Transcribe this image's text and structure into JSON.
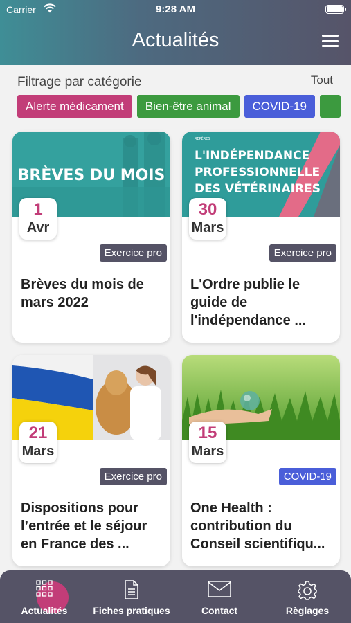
{
  "status_bar": {
    "carrier": "Carrier",
    "time": "9:28 AM"
  },
  "header": {
    "title": "Actualités"
  },
  "filter": {
    "label": "Filtrage par catégorie",
    "all": "Tout",
    "chips": [
      {
        "label": "Alerte médicament",
        "color": "#c23d78"
      },
      {
        "label": "Bien-être animal",
        "color": "#3c9a3f"
      },
      {
        "label": "COVID-19",
        "color": "#4a5ed9"
      },
      {
        "label": "",
        "color": "#3c9a3f"
      }
    ]
  },
  "articles": [
    {
      "day": "1",
      "month": "Avr",
      "tag": "Exercice pro",
      "tag_color": "#555366",
      "title": "Brèves du mois de mars 2022",
      "image_text": "BRÈVES DU MOIS"
    },
    {
      "day": "30",
      "month": "Mars",
      "tag": "Exercice pro",
      "tag_color": "#555366",
      "title": "L'Ordre publie le guide de l'indépendance ...",
      "image_text": [
        "REPÈRES",
        "L'INDÉPENDANCE",
        "PROFESSIONNELLE",
        "DES VÉTÉRINAIRES"
      ]
    },
    {
      "day": "21",
      "month": "Mars",
      "tag": "Exercice pro",
      "tag_color": "#555366",
      "title": "Dispositions pour l’entrée et le séjour en France des ..."
    },
    {
      "day": "15",
      "month": "Mars",
      "tag": "COVID-19",
      "tag_color": "#4a5ed9",
      "title": "One Health : contribution du Conseil scientifiqu..."
    }
  ],
  "tabbar": {
    "tabs": [
      {
        "label": "Actualités",
        "icon": "grid-icon",
        "active": true
      },
      {
        "label": "Fiches pratiques",
        "icon": "document-icon"
      },
      {
        "label": "Contact",
        "icon": "envelope-icon"
      },
      {
        "label": "Règlages",
        "icon": "gear-icon"
      }
    ],
    "active_color": "#c23d78"
  }
}
